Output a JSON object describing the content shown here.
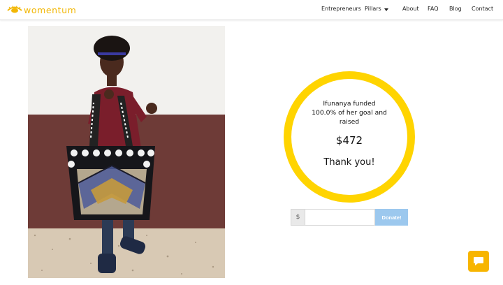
{
  "brand": {
    "name": "womentum",
    "logo_icon": "eye-logo-icon",
    "accent_color": "#f2b705"
  },
  "nav": {
    "items": [
      "Entrepreneurs",
      "Pillars",
      "About",
      "FAQ",
      "Blog",
      "Contact"
    ],
    "pillars_caret_icon": "caret-down-icon"
  },
  "photo": {
    "subject": "woman-holding-polka-dot-tote-bag"
  },
  "campaign": {
    "funded_text_line1": "Ifunanya funded",
    "funded_text_line2": "100.0% of her goal and",
    "funded_text_line3": "raised",
    "amount_raised": "$472",
    "thanks": "Thank you!",
    "ring_color": "#ffd400"
  },
  "donate": {
    "currency_symbol": "$",
    "amount_value": "",
    "amount_placeholder": "",
    "button_label": "Donate!",
    "button_color": "#9cc8ee"
  },
  "chat": {
    "icon": "chat-bubble-icon",
    "color": "#f7b500"
  }
}
